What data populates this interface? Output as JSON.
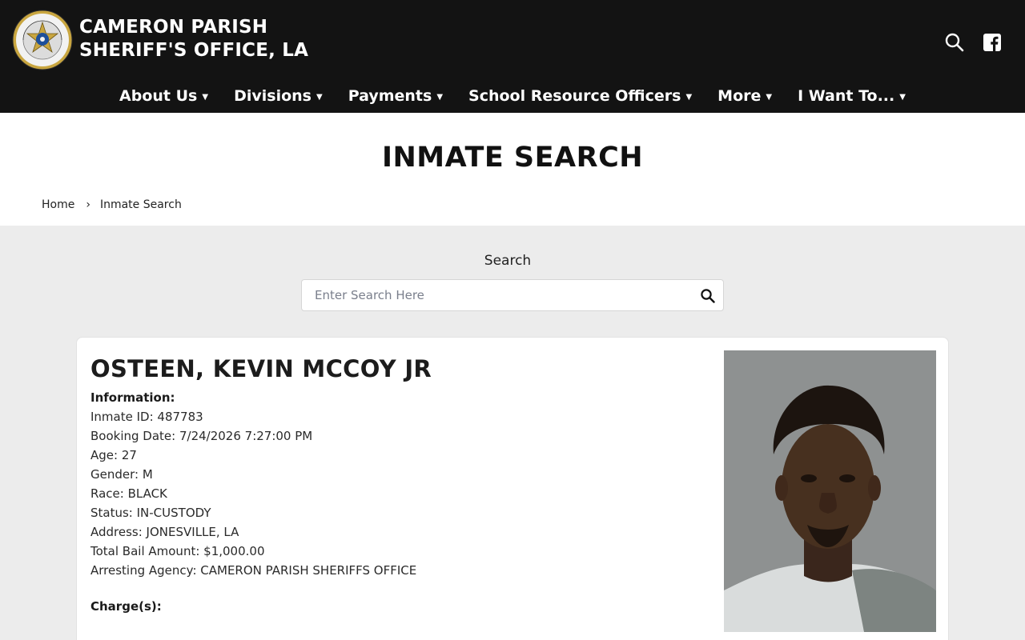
{
  "header": {
    "brand_line1": "CAMERON PARISH",
    "brand_line2": "SHERIFF'S OFFICE, LA",
    "logo_text_top": "CAMERON PARISH",
    "logo_text_bottom": "SHERIFF'S OFFICE"
  },
  "nav": [
    {
      "label": "About Us"
    },
    {
      "label": "Divisions"
    },
    {
      "label": "Payments"
    },
    {
      "label": "School Resource Officers"
    },
    {
      "label": "More"
    },
    {
      "label": "I Want To..."
    }
  ],
  "page": {
    "title": "INMATE SEARCH",
    "breadcrumb_home": "Home",
    "breadcrumb_sep": "›",
    "breadcrumb_current": "Inmate Search"
  },
  "search": {
    "label": "Search",
    "placeholder": "Enter Search Here",
    "value": ""
  },
  "inmate": {
    "name": "OSTEEN, KEVIN MCCOY JR",
    "info_header": "Information:",
    "inmate_id": "Inmate ID: 487783",
    "booking_date": "Booking Date: 7/24/2026 7:27:00 PM",
    "age": "Age: 27",
    "gender": "Gender: M",
    "race": "Race: BLACK",
    "status": "Status: IN-CUSTODY",
    "address": "Address: JONESVILLE, LA",
    "bail": "Total Bail Amount: $1,000.00",
    "agency": "Arresting Agency: CAMERON PARISH SHERIFFS OFFICE",
    "charges_header": "Charge(s):"
  },
  "colors": {
    "header_bg": "#131313",
    "page_bg": "#ececec",
    "card_bg": "#ffffff"
  }
}
